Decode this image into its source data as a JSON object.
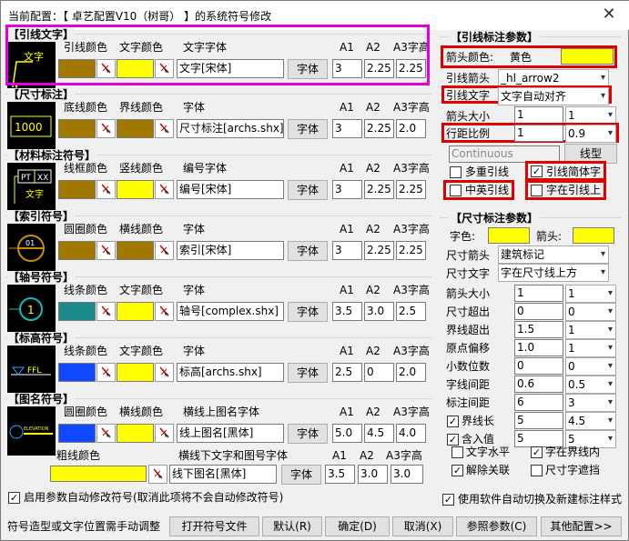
{
  "window": {
    "title": "当前配置：【 卓艺配置V10（树哥） 】的系统符号修改",
    "close": "✕"
  },
  "colors": {
    "olive": "#a07800",
    "yellow": "#ffff00",
    "teal": "#1b8a8a",
    "blue": "#1048ff",
    "magenta_highlight": "#e000e0",
    "red_highlight": "#e00000"
  },
  "sections": {
    "leader_text": {
      "title": "【引线文字】",
      "col1": "引线颜色",
      "col2": "文字颜色",
      "col3": "文字字体",
      "font_value": "文字[宋体]",
      "font_btn": "字体",
      "a1": "3",
      "a2": "2.25",
      "a3": "2.25",
      "icon_text": "文字"
    },
    "dimension": {
      "title": "【尺寸标注】",
      "col1": "底线颜色",
      "col2": "界线颜色",
      "col3": "字体",
      "font_value": "尺寸标注[archs.shx]",
      "font_btn": "字体",
      "a1": "3",
      "a2": "2.25",
      "a3": "2.0",
      "icon_text": "1000"
    },
    "material": {
      "title": "【材料标注符号】",
      "col1": "线框颜色",
      "col2": "竖线颜色",
      "col3": "编号字体",
      "font_value": "编号[宋体]",
      "font_btn": "字体",
      "a1": "3",
      "a2": "2.25",
      "a3": "2.25",
      "icon_text1": "PT",
      "icon_text2": "XX",
      "icon_text3": "文字"
    },
    "index": {
      "title": "【索引符号】",
      "col1": "圆圈颜色",
      "col2": "横线颜色",
      "col3": "字体",
      "font_value": "索引[宋体]",
      "font_btn": "字体",
      "a1": "3",
      "a2": "2.25",
      "a3": "2.25",
      "icon_text": "01"
    },
    "axis": {
      "title": "【轴号符号】",
      "col1": "线条颜色",
      "col2": "文字颜色",
      "col3": "字体",
      "font_value": "轴号[complex.shx]",
      "font_btn": "字体",
      "a1": "3.5",
      "a2": "3.0",
      "a3": "2.5"
    },
    "elevation": {
      "title": "【标高符号】",
      "col1": "线条颜色",
      "col2": "文字颜色",
      "col3": "字体",
      "font_value": "标高[archs.shx]",
      "font_btn": "字体",
      "a1": "2.5",
      "a2": "0",
      "a3": "2.0",
      "icon_text": "FFL"
    },
    "figure_name": {
      "title": "【图名符号】",
      "col1": "圆圈颜色",
      "col2": "横线颜色",
      "col3": "横线上图名字体",
      "font_value": "线上图名[黑体]",
      "font_btn": "字体",
      "a1": "5.0",
      "a2": "4.5",
      "a3": "4.0",
      "thick_label": "粗线颜色",
      "col4": "横线下文字和图号字体",
      "font2_value": "线下图名[黑体]",
      "font2_btn": "字体",
      "b1": "3.5",
      "b2": "3.0",
      "b3": "3.0",
      "icon_text": "ELEVATION"
    }
  },
  "a_headers": {
    "h1": "A1",
    "h2": "A2",
    "h3": "A3字高"
  },
  "leader_params": {
    "title": "【引线标注参数】",
    "arrow_color_label": "箭头颜色:",
    "arrow_color_name": "黄色",
    "arrow_label": "引线箭头",
    "arrow_value": "_hl_arrow2",
    "text_label": "引线文字",
    "text_value": "文字自动对齐",
    "arrow_size_label": "箭头大小",
    "arrow_size_value": "1",
    "arrow_size_sel": "1",
    "line_spacing_label": "行距比例",
    "line_spacing_value": "1",
    "line_spacing_sel": "0.9",
    "linetype_value": "Continuous",
    "linetype_btn": "线型",
    "multi_leader": "多重引线",
    "multi_leader_checked": "",
    "simplified": "引线简体字",
    "simplified_checked": "✓",
    "cn_en": "中英引线",
    "cn_en_checked": "",
    "on_line": "字在引线上",
    "on_line_checked": ""
  },
  "dim_params": {
    "title": "【尺寸标注参数】",
    "text_color": "字色:",
    "arrow_color": "箭头:",
    "dim_arrow_label": "尺寸箭头",
    "dim_arrow_value": "建筑标记",
    "dim_text_label": "尺寸文字",
    "dim_text_value": "字在尺寸线上方",
    "rows": [
      {
        "label": "箭头大小",
        "value": "1",
        "sel": "1",
        "checked": "",
        "has_check": false
      },
      {
        "label": "尺寸超出",
        "value": "0",
        "sel": "0",
        "checked": "",
        "has_check": false
      },
      {
        "label": "界线超出",
        "value": "1.5",
        "sel": "1",
        "checked": "",
        "has_check": false
      },
      {
        "label": "原点偏移",
        "value": "1.0",
        "sel": "1",
        "checked": "",
        "has_check": false
      },
      {
        "label": "小数位数",
        "value": "0",
        "sel": "0",
        "checked": "",
        "has_check": false
      },
      {
        "label": "字线间距",
        "value": "0.6",
        "sel": "0.5",
        "checked": "",
        "has_check": false
      },
      {
        "label": "标注间距",
        "value": "6",
        "sel": "3",
        "checked": "",
        "has_check": false
      },
      {
        "label": "界线长",
        "value": "5",
        "sel": "4.5",
        "checked": "✓",
        "has_check": true
      },
      {
        "label": "含入值",
        "value": "5",
        "sel": "5",
        "checked": "✓",
        "has_check": true
      }
    ],
    "text_horizontal": "文字水平",
    "text_horizontal_checked": "",
    "text_in_ext": "字在界线内",
    "text_in_ext_checked": "✓",
    "unassoc": "解除关联",
    "unassoc_checked": "✓",
    "dim_mask": "尺寸字遮挡",
    "dim_mask_checked": ""
  },
  "bottom": {
    "auto_modify": "启用参数自动修改符号(取消此项将不会自动修改符号)",
    "auto_modify_checked": "✓",
    "auto_switch": "使用软件自动切换及新建标注样式",
    "auto_switch_checked": "✓",
    "note": "符号造型或文字位置需手动调整",
    "open_btn": "打开符号文件",
    "default_btn": "默认(R)",
    "ok_btn": "确定(D)",
    "cancel_btn": "取消(X)",
    "ref_btn": "参照参数(C)",
    "more_btn": "其他配置>>"
  }
}
